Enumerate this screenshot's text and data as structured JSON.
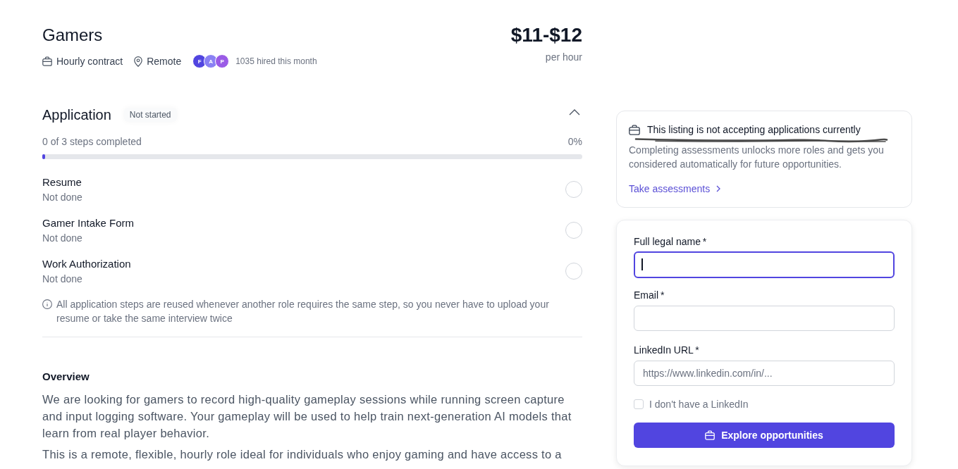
{
  "header": {
    "title": "Gamers",
    "meta": [
      {
        "kind": "contract",
        "text": "Hourly contract"
      },
      {
        "kind": "location",
        "text": "Remote"
      }
    ],
    "avatars": [
      {
        "initial": "F",
        "color": "#5145e0"
      },
      {
        "initial": "A",
        "color": "#8a80f4"
      },
      {
        "initial": "P",
        "color": "#9a5be6"
      }
    ],
    "hired": "1035 hired this month",
    "price": "$11-$12",
    "price_unit": "per hour"
  },
  "application": {
    "title": "Application",
    "status": "Not started",
    "expanded": true,
    "progress_text": "0 of 3 steps completed",
    "progress_percent": "0%",
    "level": 0,
    "steps": [
      {
        "name": "Resume",
        "status": "Not done",
        "done": false
      },
      {
        "name": "Gamer Intake Form",
        "status": "Not done",
        "done": false
      },
      {
        "name": "Work Authorization",
        "status": "Not done",
        "done": false
      }
    ],
    "note": "All application steps are reused whenever another role requires the same step, so you never have to upload your resume or take the same interview twice"
  },
  "overview": {
    "title": "Overview",
    "paragraphs": [
      "We are looking for gamers to record high-quality gameplay sessions while running screen capture and input logging software. Your gameplay will be used to help train next-generation AI models that learn from real player behavior.",
      "This is a remote, flexible, hourly role ideal for individuals who enjoy gaming and have access to a"
    ]
  },
  "notice": {
    "title": "This listing is not accepting applications currently",
    "body": "Completing assessments unlocks more roles and gets you considered automatically for future opportunities.",
    "link": "Take assessments"
  },
  "form": {
    "fields": [
      {
        "label": "Full legal name",
        "required_mark": "*",
        "focused": true
      },
      {
        "label": "Email",
        "required_mark": "*",
        "focused": false
      },
      {
        "label": "LinkedIn URL",
        "required_mark": "*",
        "placeholder": "https://www.linkedin.com/in/...",
        "focused": false
      }
    ],
    "checkbox": {
      "label": "I don't have a LinkedIn",
      "checked": false
    },
    "submit": "Explore opportunities"
  }
}
